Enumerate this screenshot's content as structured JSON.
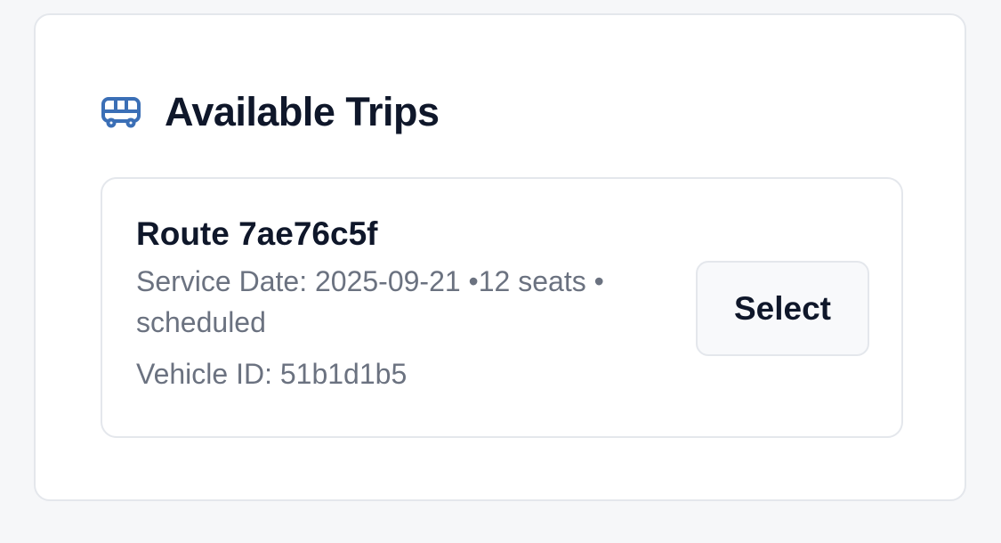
{
  "panel": {
    "title": "Available Trips",
    "icon": "bus-icon",
    "accent_color": "#3b6fb6"
  },
  "trips": [
    {
      "route_label": "Route 7ae76c5f",
      "service_date_label": "Service Date: 2025-09-21",
      "seats": "12 seats",
      "separator": "•",
      "status": "scheduled",
      "vehicle_label": "Vehicle ID: 51b1d1b5",
      "select_label": "Select"
    }
  ]
}
